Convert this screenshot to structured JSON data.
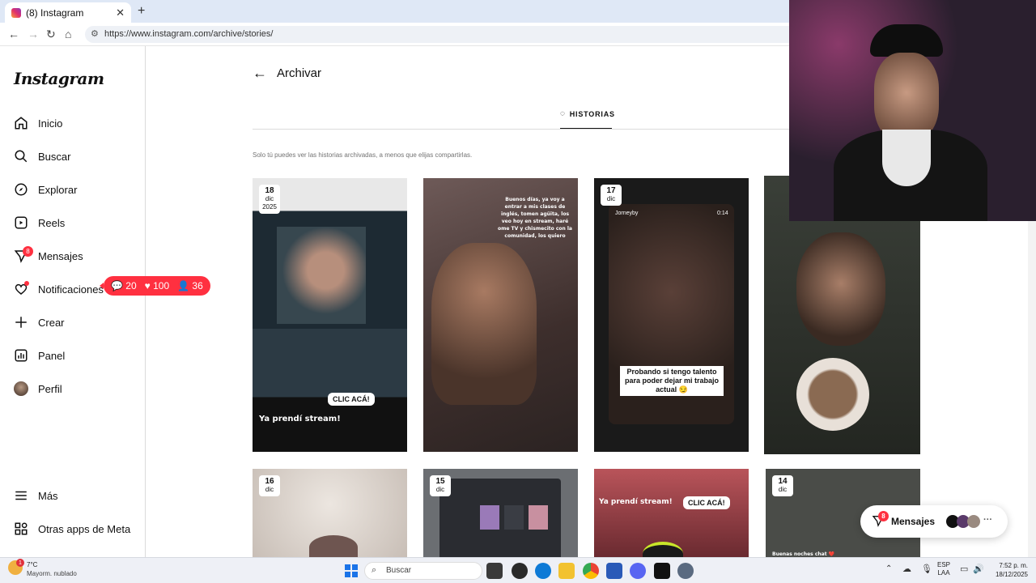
{
  "browser": {
    "tab_title": "(8) Instagram",
    "url": "https://www.instagram.com/archive/stories/"
  },
  "sidebar": {
    "logo": "Instagram",
    "items": [
      {
        "label": "Inicio",
        "icon": "home-icon"
      },
      {
        "label": "Buscar",
        "icon": "search-icon"
      },
      {
        "label": "Explorar",
        "icon": "compass-icon"
      },
      {
        "label": "Reels",
        "icon": "reels-icon"
      },
      {
        "label": "Mensajes",
        "icon": "messenger-icon",
        "badge": "8"
      },
      {
        "label": "Notificaciones",
        "icon": "heart-icon"
      },
      {
        "label": "Crear",
        "icon": "plus-icon"
      },
      {
        "label": "Panel",
        "icon": "dashboard-icon"
      },
      {
        "label": "Perfil",
        "icon": "avatar"
      }
    ],
    "bottom": [
      {
        "label": "Más",
        "icon": "menu-icon"
      },
      {
        "label": "Otras apps de Meta",
        "icon": "meta-apps-icon"
      }
    ],
    "notif_pill": {
      "comments": "20",
      "likes": "100",
      "followers": "36"
    }
  },
  "main": {
    "title": "Archivar",
    "tab": "HISTORIAS",
    "hint": "Solo tú puedes ver las historias archivadas, a menos que elijas compartirlas.",
    "stories": [
      {
        "day": "18",
        "month": "dic",
        "year": "2025",
        "caption": "Ya prendí stream!",
        "sticker": "CLIC ACÁ!"
      },
      {
        "day": "",
        "month": "",
        "year": "",
        "caption": "Buenos días, ya voy a entrar a mis clases de inglés, tomen agüita, los veo hoy en stream, haré ome TV y chismecito con la comunidad, los quiero",
        "sticker": ""
      },
      {
        "day": "17",
        "month": "dic",
        "year": "",
        "caption": "Probando si tengo talento para poder dejar mi trabajo actual 😏",
        "sticker": "",
        "user": "Jorneyby",
        "time": "0:14"
      },
      {
        "day": "",
        "month": "",
        "year": "",
        "caption": "",
        "sticker": ""
      },
      {
        "day": "16",
        "month": "dic",
        "year": "",
        "caption": "",
        "sticker": ""
      },
      {
        "day": "15",
        "month": "dic",
        "year": "",
        "caption": "",
        "sticker": ""
      },
      {
        "day": "",
        "month": "",
        "year": "",
        "caption": "Ya prendí stream!",
        "sticker": "CLIC ACÁ!"
      },
      {
        "day": "14",
        "month": "dic",
        "year": "",
        "caption": "Buenas noches chat ❤️",
        "sticker": ""
      }
    ]
  },
  "messages_float": {
    "label": "Mensajes",
    "badge": "8"
  },
  "taskbar": {
    "weather_temp": "7°C",
    "weather_desc": "Mayorm. nublado",
    "weather_badge": "1",
    "search_placeholder": "Buscar",
    "lang1": "ESP",
    "lang2": "LAA",
    "time": "7:52 p. m.",
    "date": "18/12/2025"
  },
  "colors": {
    "accent": "#ff3040",
    "border": "#dbdbdb",
    "muted": "#737373"
  }
}
